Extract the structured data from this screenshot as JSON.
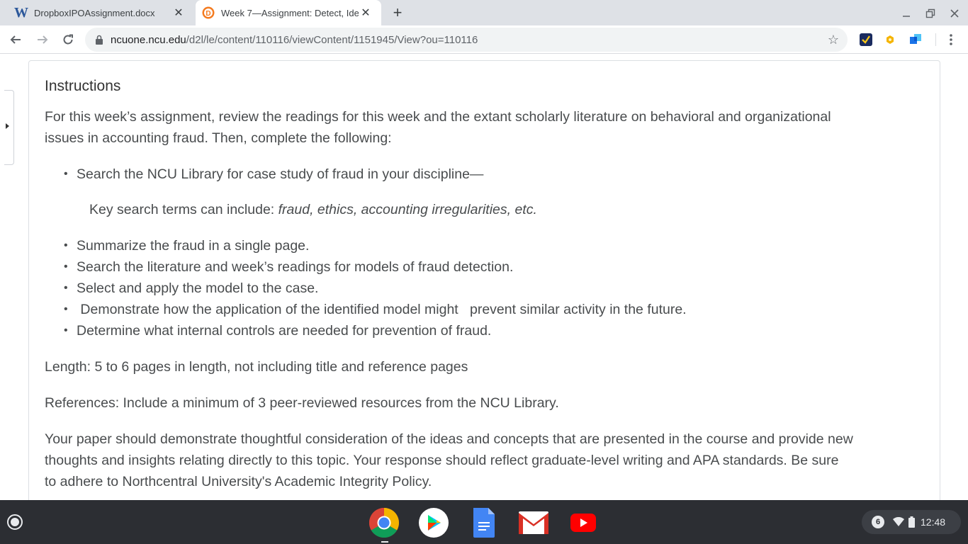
{
  "tabs": [
    {
      "title": "DropboxIPOAssignment.docx",
      "favicon": "W",
      "active": false
    },
    {
      "title": "Week 7—Assignment: Detect, Ide",
      "favicon": "D",
      "active": true
    }
  ],
  "toolbar": {
    "url_host": "ncuone.ncu.edu",
    "url_path": "/d2l/le/content/110116/viewContent/1151945/View?ou=110116"
  },
  "content": {
    "heading": "Instructions",
    "intro_line1": "For this week’s assignment, review the readings for this week and the extant scholarly literature on behavioral and organizational",
    "intro_line2": "issues in accounting fraud. Then, complete the following:",
    "bullet1": "Search the NCU Library for case study of fraud in your discipline—",
    "sub_prefix": "Key search terms can include: ",
    "sub_italic": "fraud, ethics, accounting irregularities, etc.",
    "bullets": [
      "Summarize the fraud in a single page.",
      "Search the literature and week’s readings for models of fraud detection.",
      "Select and apply the model to the case.",
      " Demonstrate how the application of the identified model might   prevent similar activity in the future.",
      "Determine what internal controls are needed for prevention of fraud."
    ],
    "length": "Length: 5 to 6 pages in length, not including title and reference pages",
    "references": "References: Include a minimum of 3 peer-reviewed resources from the NCU Library.",
    "closing_line1": "Your paper should demonstrate thoughtful consideration of the ideas and concepts that are presented in the course and provide new",
    "closing_line2": "thoughts and insights relating directly to this topic. Your response should reflect graduate-level writing and APA standards. Be sure",
    "closing_line3": "to adhere to Northcentral University's Academic Integrity Policy."
  },
  "shelf": {
    "apps": [
      "chrome-icon",
      "play-store-icon",
      "docs-icon",
      "gmail-icon",
      "youtube-icon"
    ],
    "notification_count": "6",
    "time": "12:48"
  },
  "colors": {
    "tabstrip": "#dee1e6",
    "shelf": "#2c2e33",
    "body_text": "#494c4e"
  }
}
